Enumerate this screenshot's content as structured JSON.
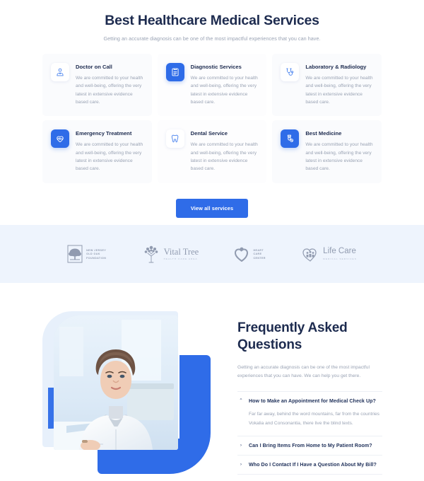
{
  "services": {
    "title": "Best Healthcare Medical Services",
    "subtitle": "Getting an accurate diagnosis can be one of the most impactful experiences that you can have.",
    "cards": [
      {
        "title": "Doctor on Call",
        "text": "We are committed to your health and well-being, offering the very latest in extensive evidence based care.",
        "icon": "doctor-icon",
        "icon_style": "light"
      },
      {
        "title": "Diagnostic Services",
        "text": "We are committed to your health and well-being, offering the very latest in extensive evidence based care.",
        "icon": "clipboard-report-icon",
        "icon_style": "filled"
      },
      {
        "title": "Laboratory & Radiology",
        "text": "We are committed to your health and well-being, offering the very latest in extensive evidence based care.",
        "icon": "stethoscope-icon",
        "icon_style": "light"
      },
      {
        "title": "Emergency Treatment",
        "text": "We are committed to your health and well-being, offering the very latest in extensive evidence based care.",
        "icon": "heartbeat-icon",
        "icon_style": "filled"
      },
      {
        "title": "Dental Service",
        "text": "We are committed to your health and well-being, offering the very latest in extensive evidence based care.",
        "icon": "tooth-icon",
        "icon_style": "light"
      },
      {
        "title": "Best Medicine",
        "text": "We are committed to your health and well-being, offering the very latest in extensive evidence based care.",
        "icon": "medicine-bottle-icon",
        "icon_style": "filled"
      }
    ],
    "cta_label": "View all services"
  },
  "partners": [
    {
      "name_lines": [
        "NEW JERSEY",
        "OLD OAK",
        "FOUNDATION"
      ],
      "icon": "oak-tree-logo-icon"
    },
    {
      "word": "Vital Tree",
      "tagline": "HEALTH CARE AREA",
      "icon": "tree-logo-icon"
    },
    {
      "name_lines": [
        "HEART",
        "CARE",
        "CENTER"
      ],
      "icon": "heart-person-logo-icon"
    },
    {
      "word": "Life Care",
      "tagline": "MEDICAL SERVICES",
      "icon": "heart-family-logo-icon"
    }
  ],
  "faq": {
    "title": "Frequently Asked Questions",
    "description": "Getting an accurate diagnosis can be one of the most impactful experiences that you can have. We can help you get there.",
    "photo_alt": "female-doctor-photo",
    "items": [
      {
        "question": "How to Make an Appointment for Medical Check Up?",
        "answer": "Far far away, behind the word mountains, far from the countries Vokalia and Consonantia, there live the blind texts.",
        "expanded": true,
        "chevron": "⌃"
      },
      {
        "question": "Can I Bring Items From Home to My Patient Room?",
        "answer": "",
        "expanded": false,
        "chevron": "›"
      },
      {
        "question": "Who Do I Contact If I Have a Question About My Bill?",
        "answer": "",
        "expanded": false,
        "chevron": "›"
      }
    ]
  },
  "colors": {
    "accent": "#2f6ce8",
    "heading": "#1d2b4f",
    "muted": "#9aa3b4",
    "band": "#eef4fd"
  }
}
